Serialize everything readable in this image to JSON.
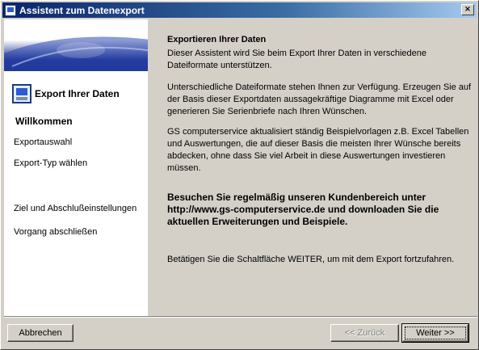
{
  "window": {
    "title": "Assistent zum Datenexport",
    "close_glyph": "×"
  },
  "sidebar": {
    "header_label": "Export Ihrer Daten",
    "header_icon": "export-data-icon",
    "items": [
      {
        "label": "Willkommen",
        "active": true
      },
      {
        "label": "Exportauswahl",
        "active": false
      },
      {
        "label": "Export-Typ wählen",
        "active": false
      },
      {
        "label": "Ziel und Abschlußeinstellungen",
        "active": false
      },
      {
        "label": "Vorgang abschließen",
        "active": false
      }
    ]
  },
  "content": {
    "heading": "Exportieren Ihrer Daten",
    "para1": "Dieser Assistent wird Sie beim Export Ihrer Daten in verschiedene Dateiformate unterstützen.",
    "para2": "Unterschiedliche Dateiformate stehen Ihnen zur Verfügung. Erzeugen Sie auf der Basis dieser Exportdaten aussagekräftige Diagramme mit Excel oder generieren Sie Serienbriefe nach Ihren Wünschen.",
    "para3": "GS computerservice aktualisiert ständig Beispielvorlagen z.B. Excel Tabellen und Auswertungen, die auf dieser Basis die meisten Ihrer Wünsche bereits abdecken, ohne dass Sie viel Arbeit in diese Auswertungen investieren müssen.",
    "para4": "Besuchen Sie regelmäßig unseren Kundenbereich unter http://www.gs-computerservice.de und downloaden Sie die aktuellen Erweiterungen und Beispiele.",
    "para5": "Betätigen Sie die Schaltfläche WEITER, um mit dem Export fortzufahren."
  },
  "buttons": {
    "cancel": "Abbrechen",
    "back": "<< Zurück",
    "next": "Weiter >>"
  },
  "colors": {
    "face": "#d4d0c8",
    "title_start": "#0a246a",
    "title_end": "#a6caf0",
    "banner": "#1c2f8c"
  }
}
